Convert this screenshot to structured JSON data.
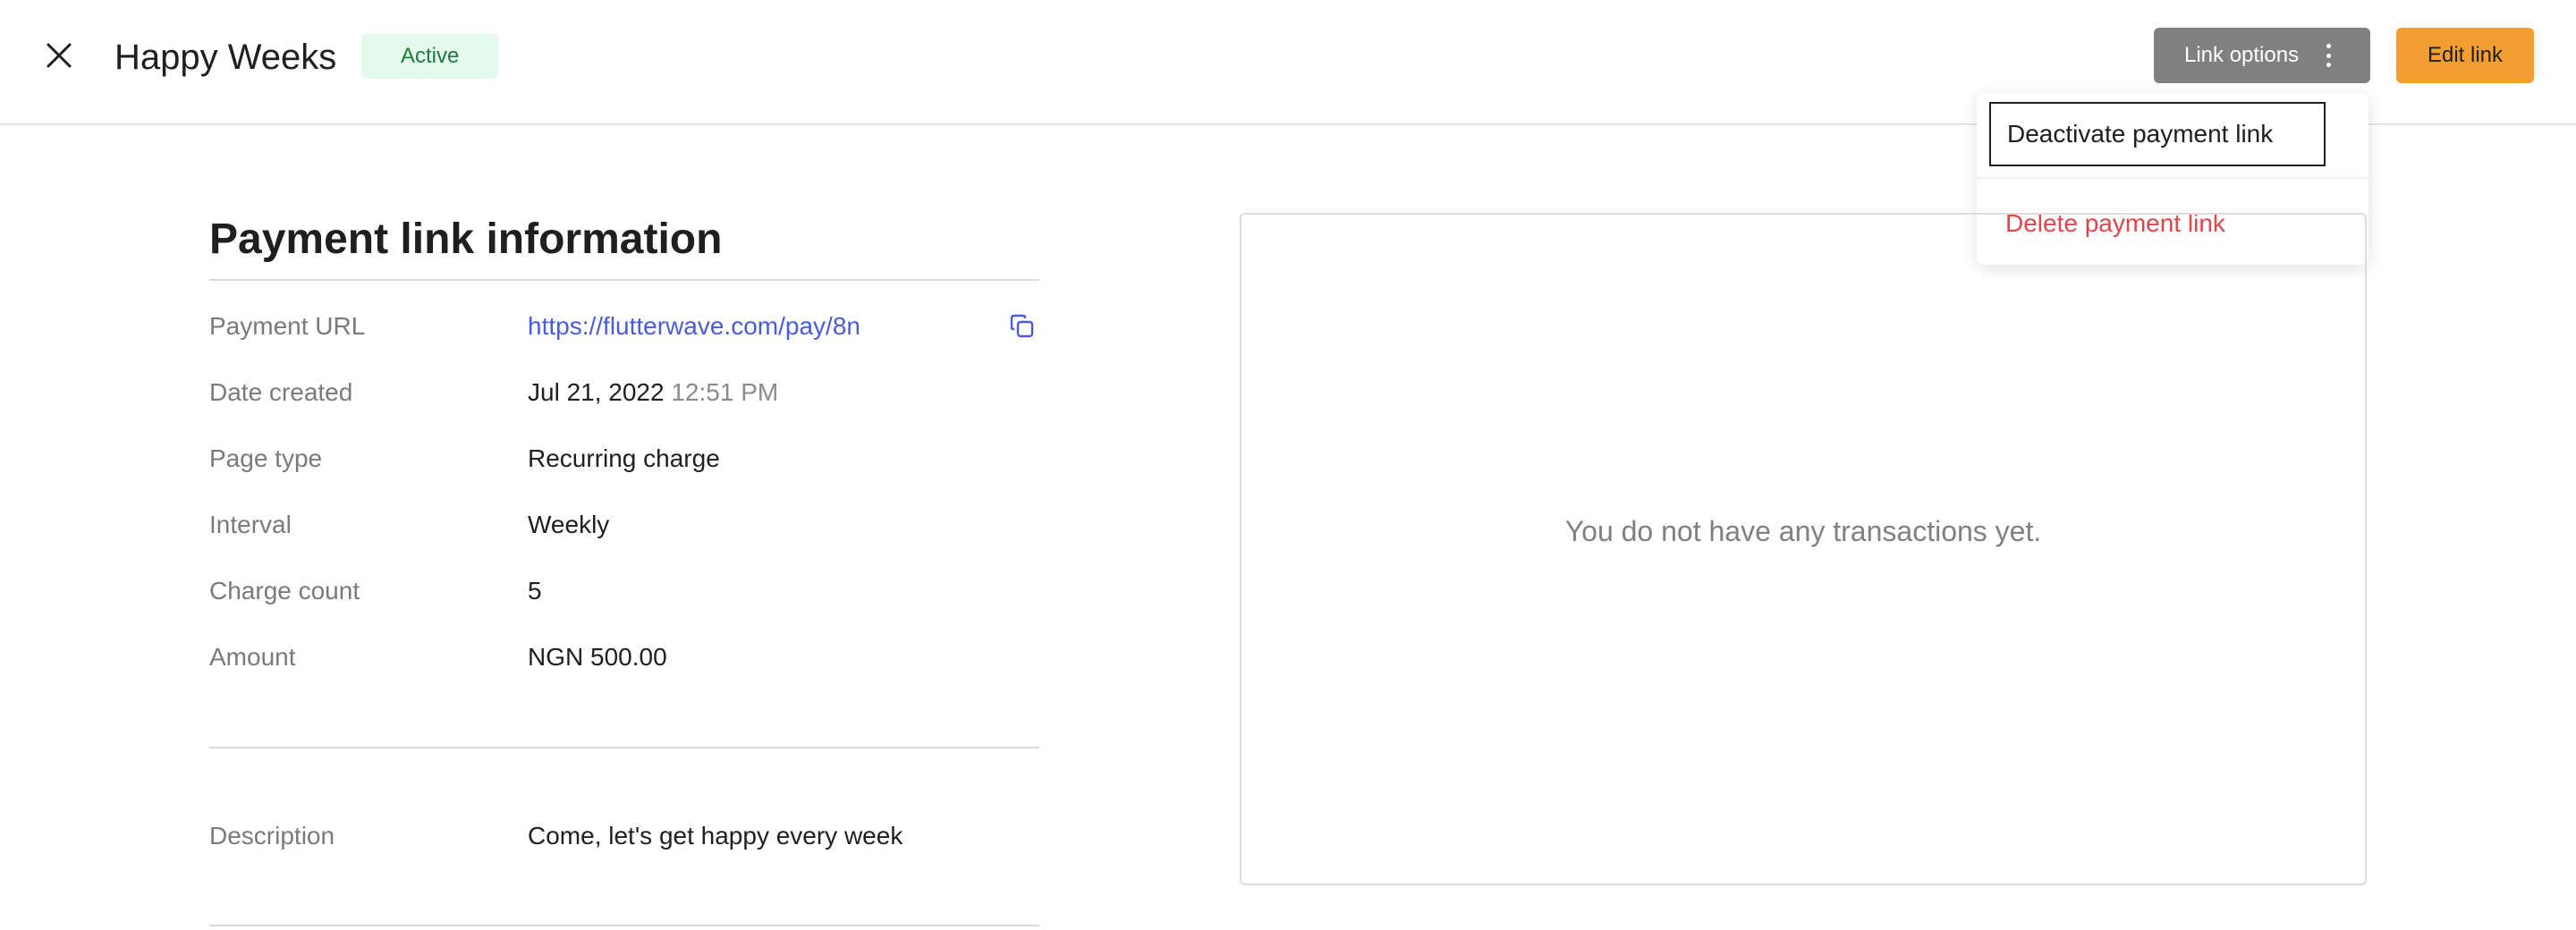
{
  "header": {
    "title": "Happy Weeks",
    "status": "Active",
    "link_options_label": "Link options",
    "edit_label": "Edit link"
  },
  "dropdown": {
    "items": [
      {
        "label": "Deactivate payment link"
      },
      {
        "label": "Delete payment link"
      }
    ]
  },
  "info": {
    "title": "Payment link information",
    "rows": [
      {
        "label": "Payment URL",
        "value": "https://flutterwave.com/pay/8n"
      },
      {
        "label": "Date created",
        "value": "Jul 21, 2022",
        "time": "12:51 PM"
      },
      {
        "label": "Page type",
        "value": "Recurring charge"
      },
      {
        "label": "Interval",
        "value": "Weekly"
      },
      {
        "label": "Charge count",
        "value": "5"
      },
      {
        "label": "Amount",
        "value": "NGN 500.00"
      }
    ],
    "description": {
      "label": "Description",
      "value": "Come, let's get happy every week"
    }
  },
  "transactions": {
    "empty_message": "You do not have any transactions yet."
  },
  "icons": {
    "close": "close-icon",
    "copy": "copy-icon",
    "kebab": "kebab-icon"
  },
  "colors": {
    "accent": "#f29e30",
    "link": "#4a5cd9",
    "danger": "#e0454a",
    "badge_bg": "#e3f9ea",
    "badge_text": "#1e7a43"
  }
}
